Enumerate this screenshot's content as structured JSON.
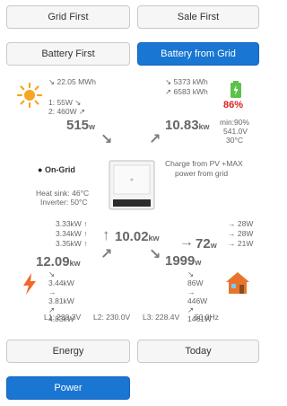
{
  "mode_buttons": {
    "grid_first": "Grid First",
    "sale_first": "Sale First",
    "battery_first": "Battery First",
    "battery_from_grid": "Battery from Grid"
  },
  "solar": {
    "energy": "22.05 MWh",
    "string1": "1: 55W",
    "string2": "2: 460W",
    "power": "515",
    "power_unit": "w"
  },
  "battery": {
    "charged": "5373 kWh",
    "discharged": "6583 kWh",
    "soc": "86%",
    "power": "10.83",
    "power_unit": "kw",
    "min_soc": "min:90%",
    "voltage": "541.0V",
    "temp": "30°C"
  },
  "inverter": {
    "status": "On-Grid",
    "heat_sink": "Heat sink: 46°C",
    "inverter_temp": "Inverter: 50°C",
    "mode_note_line1": "Charge from PV +MAX",
    "mode_note_line2": "power from grid"
  },
  "grid": {
    "phases_in": [
      "3.33kW ↑",
      "3.34kW ↑",
      "3.35kW ↑"
    ],
    "power": "10.02",
    "power_unit": "kw",
    "total": "12.09",
    "total_unit": "kw",
    "phases": [
      "3.44kW",
      "3.81kW",
      "4.83kW"
    ]
  },
  "load": {
    "backup_phases": [
      "→ 28W",
      "→ 28W",
      "→ 21W"
    ],
    "backup_power": "72",
    "backup_unit": "w",
    "home_power": "1999",
    "home_unit": "w",
    "home_phases": [
      "86W",
      "446W",
      "1461W"
    ]
  },
  "voltages": {
    "l1": "L1: 230.3V",
    "l2": "L2: 230.0V",
    "l3": "L3: 228.4V",
    "freq": "50.0Hz"
  },
  "bottom_buttons": {
    "energy": "Energy",
    "today": "Today",
    "power": "Power"
  },
  "colors": {
    "primary": "#1976d2",
    "battery_soc": "#e02020",
    "battery_fill": "#5cc24a",
    "sun": "#f5a623",
    "house": "#e8742c"
  },
  "icons": {
    "solar": "sun-icon",
    "battery": "battery-icon",
    "grid": "lightning-icon",
    "home": "house-icon",
    "inverter": "inverter-icon",
    "status": "plug-icon"
  }
}
